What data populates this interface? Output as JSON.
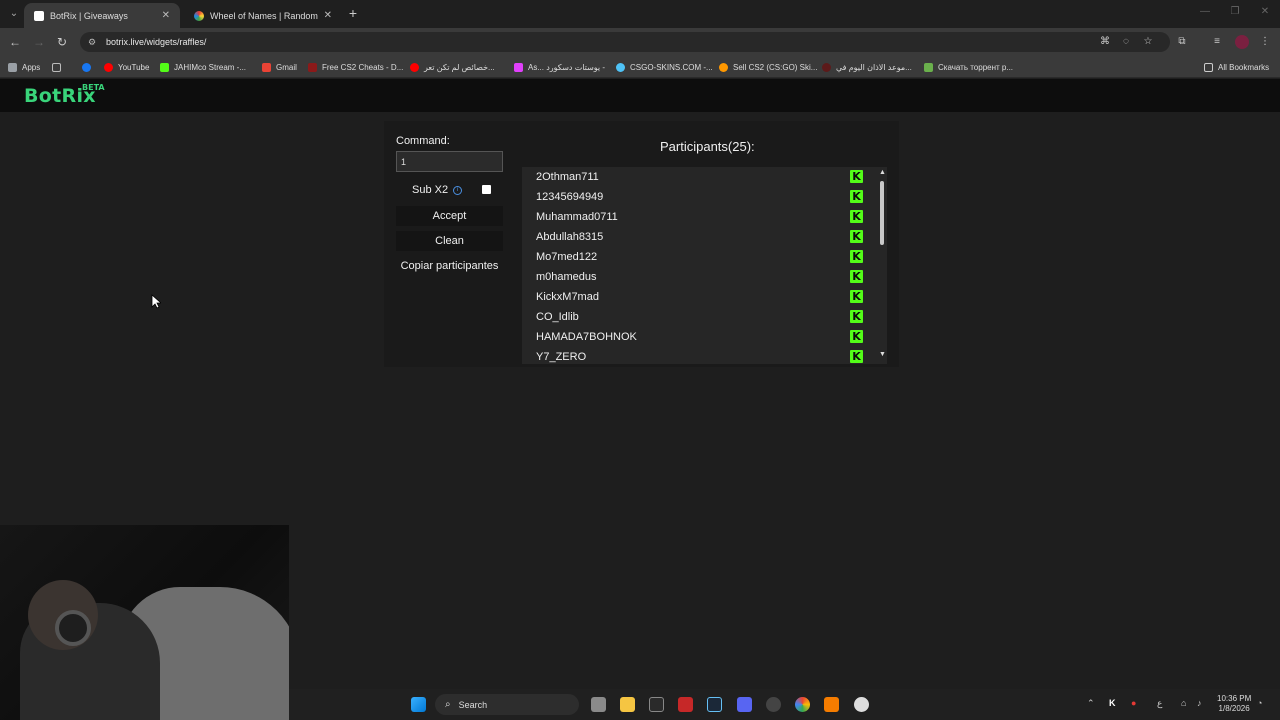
{
  "browser": {
    "tabs": [
      {
        "title": "BotRix | Giveaways",
        "active": true
      },
      {
        "title": "Wheel of Names | Random nam",
        "active": false
      }
    ],
    "url": "botrix.live/widgets/raffles/",
    "bookmarks": [
      {
        "label": "Apps",
        "color": "#9aa0a6"
      },
      {
        "label": "",
        "color": "#1877f2"
      },
      {
        "label": "YouTube",
        "color": "#ff0000"
      },
      {
        "label": "JAHIMco Stream -...",
        "color": "#53fc18"
      },
      {
        "label": "Gmail",
        "color": "#ea4335"
      },
      {
        "label": "Free CS2 Cheats - D...",
        "color": "#8b1a1a"
      },
      {
        "label": "خصائص لم تكن تعر...",
        "color": "#ff0000"
      },
      {
        "label": "As... يوستات دسكورد -",
        "color": "#e040fb"
      },
      {
        "label": "CSGO-SKINS.COM -...",
        "color": "#4fc3f7"
      },
      {
        "label": "Sell CS2 (CS:GO) Ski...",
        "color": "#ff9800"
      },
      {
        "label": "موعد الاذان اليوم في...",
        "color": "#5c1a1a"
      },
      {
        "label": "Скачать торрент р...",
        "color": "#6ab04c"
      }
    ],
    "all_bookmarks": "All Bookmarks"
  },
  "site": {
    "logo": "BotRix",
    "beta": "BETA"
  },
  "raffle": {
    "command_label": "Command:",
    "command_value": "1",
    "sub_label": "Sub X2",
    "accept_label": "Accept",
    "clean_label": "Clean",
    "copy_label": "Copiar participantes",
    "participants_title": "Participants(25):",
    "participants": [
      "2Othman711",
      "12345694949",
      "Muhammad0711",
      "Abdullah8315",
      "Mo7med122",
      "m0hamedus",
      "KickxM7mad",
      "CO_Idlib",
      "HAMADA7BOHNOK",
      "Y7_ZERO"
    ]
  },
  "taskbar": {
    "search_label": "Search",
    "time": "10:36 PM",
    "date": "1/8/2026",
    "lang": "ع"
  },
  "colors": {
    "brand": "#39d47a",
    "kick": "#53fc18"
  }
}
